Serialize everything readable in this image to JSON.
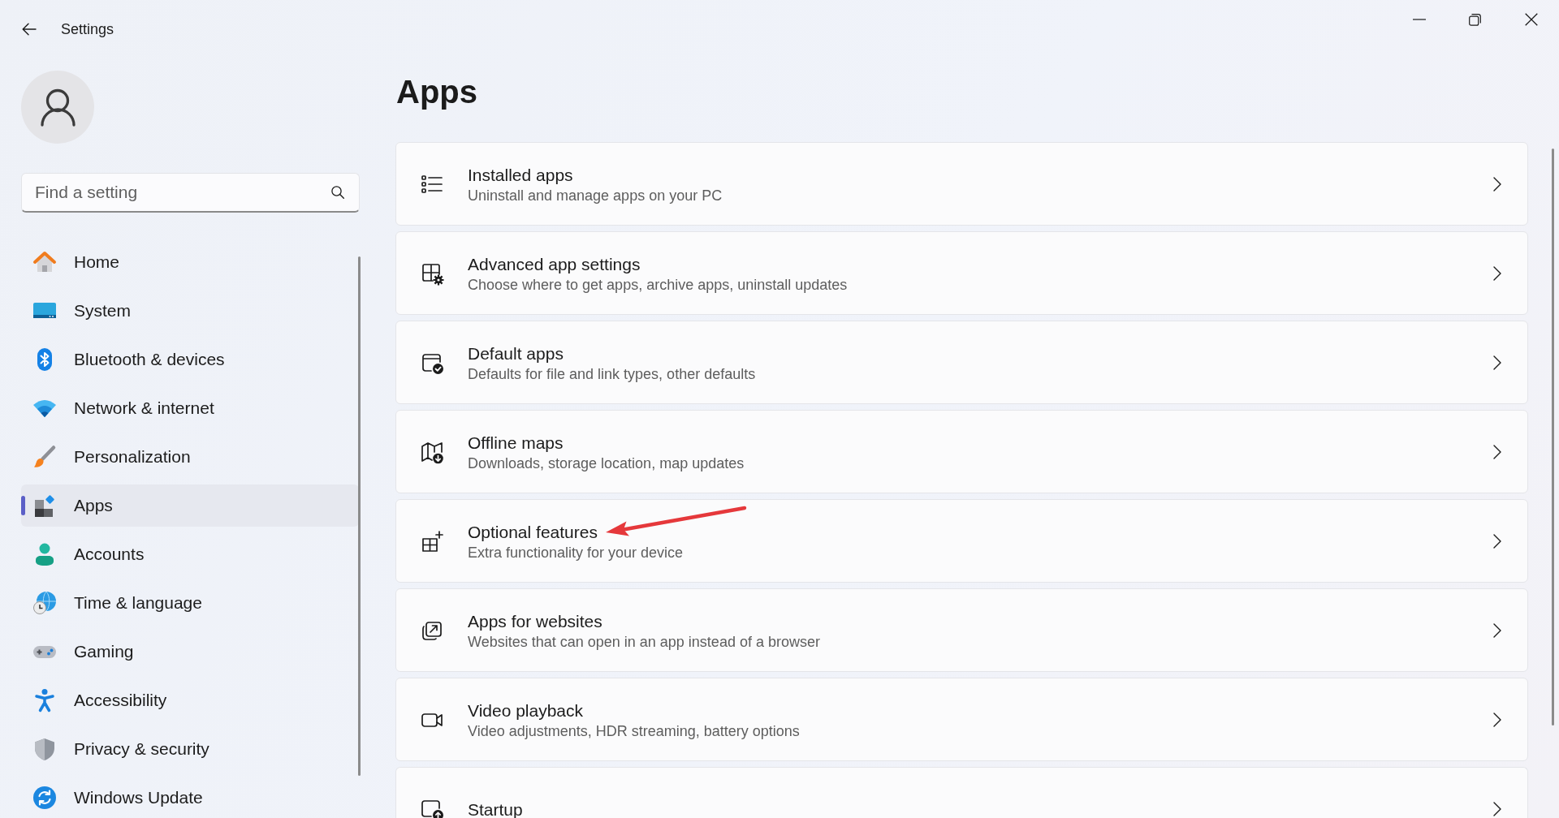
{
  "window": {
    "title": "Settings"
  },
  "search": {
    "placeholder": "Find a setting"
  },
  "sidebar": {
    "items": [
      {
        "label": "Home",
        "kind": "home",
        "selected": false
      },
      {
        "label": "System",
        "kind": "system",
        "selected": false
      },
      {
        "label": "Bluetooth & devices",
        "kind": "bluetooth",
        "selected": false
      },
      {
        "label": "Network & internet",
        "kind": "network",
        "selected": false
      },
      {
        "label": "Personalization",
        "kind": "personalization",
        "selected": false
      },
      {
        "label": "Apps",
        "kind": "apps",
        "selected": true
      },
      {
        "label": "Accounts",
        "kind": "accounts",
        "selected": false
      },
      {
        "label": "Time & language",
        "kind": "time",
        "selected": false
      },
      {
        "label": "Gaming",
        "kind": "gaming",
        "selected": false
      },
      {
        "label": "Accessibility",
        "kind": "accessibility",
        "selected": false
      },
      {
        "label": "Privacy & security",
        "kind": "privacy",
        "selected": false
      },
      {
        "label": "Windows Update",
        "kind": "update",
        "selected": false
      }
    ]
  },
  "page": {
    "title": "Apps"
  },
  "cards": [
    {
      "title": "Installed apps",
      "description": "Uninstall and manage apps on your PC",
      "kind": "installed",
      "arrow": false
    },
    {
      "title": "Advanced app settings",
      "description": "Choose where to get apps, archive apps, uninstall updates",
      "kind": "advanced",
      "arrow": false
    },
    {
      "title": "Default apps",
      "description": "Defaults for file and link types, other defaults",
      "kind": "default",
      "arrow": false
    },
    {
      "title": "Offline maps",
      "description": "Downloads, storage location, map updates",
      "kind": "maps",
      "arrow": false
    },
    {
      "title": "Optional features",
      "description": "Extra functionality for your device",
      "kind": "optional",
      "arrow": true
    },
    {
      "title": "Apps for websites",
      "description": "Websites that can open in an app instead of a browser",
      "kind": "websites",
      "arrow": false
    },
    {
      "title": "Video playback",
      "description": "Video adjustments, HDR streaming, battery options",
      "kind": "video",
      "arrow": false
    },
    {
      "title": "Startup",
      "kind": "startup",
      "arrow": false
    }
  ]
}
